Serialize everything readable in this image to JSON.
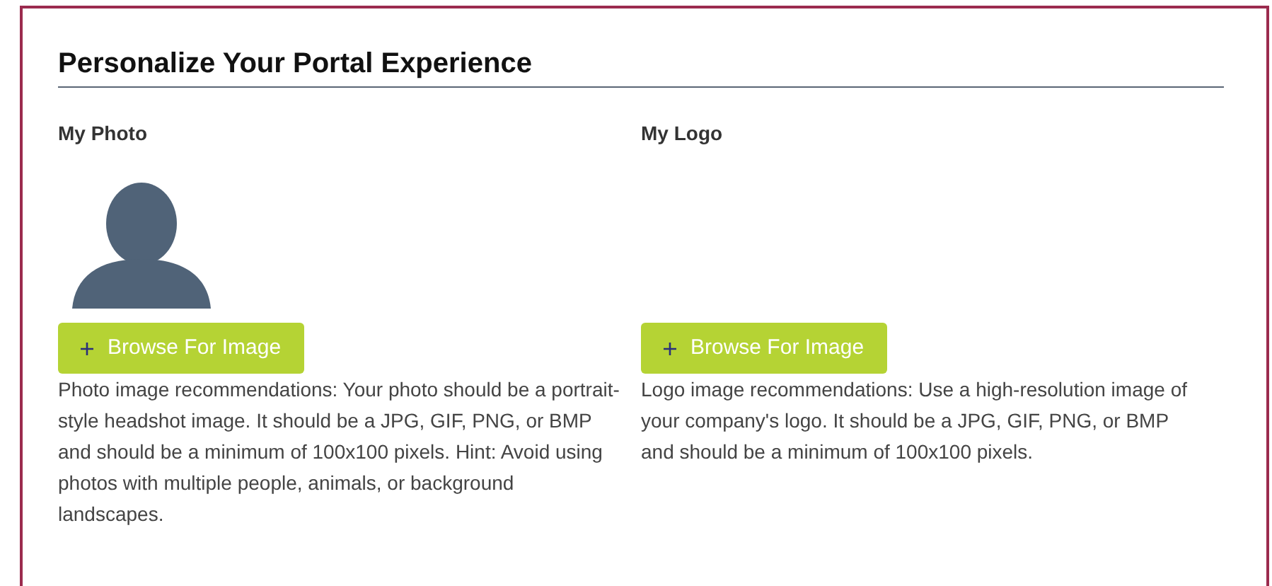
{
  "title": "Personalize Your Portal Experience",
  "sections": [
    {
      "label": "My Photo",
      "kind": "avatar",
      "button": "Browse For Image",
      "description": "Photo image recommendations: Your photo should be a portrait-style headshot image. It should be a JPG, GIF, PNG, or BMP and should be a minimum of 100x100 pixels. Hint: Avoid using photos with multiple people, animals, or background landscapes."
    },
    {
      "label": "My Logo",
      "kind": "empty",
      "button": "Browse For Image",
      "description": "Logo image recommendations: Use a high-resolution image of your company's logo. It should be a JPG, GIF, PNG, or BMP and should be a minimum of 100x100 pixels."
    }
  ]
}
